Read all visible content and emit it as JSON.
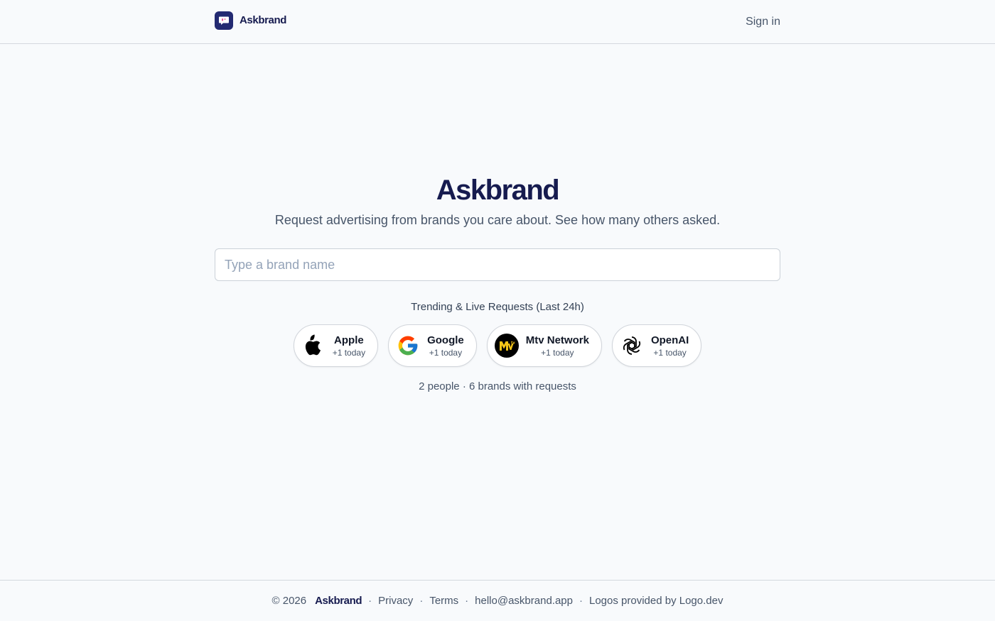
{
  "header": {
    "brand_name": "Askbrand",
    "signin_label": "Sign in"
  },
  "hero": {
    "title": "Askbrand",
    "subtitle": "Request advertising from brands you care about. See how many others asked."
  },
  "search": {
    "placeholder": "Type a brand name",
    "value": ""
  },
  "trending": {
    "title": "Trending & Live Requests (Last 24h)",
    "items": [
      {
        "name": "Apple",
        "count": "+1 today",
        "icon": "apple-logo-icon"
      },
      {
        "name": "Google",
        "count": "+1 today",
        "icon": "google-logo-icon"
      },
      {
        "name": "Mtv Network",
        "count": "+1 today",
        "icon": "mtv-logo-icon"
      },
      {
        "name": "OpenAI",
        "count": "+1 today",
        "icon": "openai-logo-icon"
      }
    ]
  },
  "stats": "2 people · 6 brands with requests",
  "footer": {
    "copyright": "© 2026",
    "brand": "Askbrand",
    "privacy": "Privacy",
    "terms": "Terms",
    "email": "hello@askbrand.app",
    "logos_credit": "Logos provided by Logo.dev",
    "separator": "·"
  },
  "colors": {
    "brand_navy": "#161b4f",
    "logo_bg": "#232a72",
    "background": "#f8fafc"
  }
}
